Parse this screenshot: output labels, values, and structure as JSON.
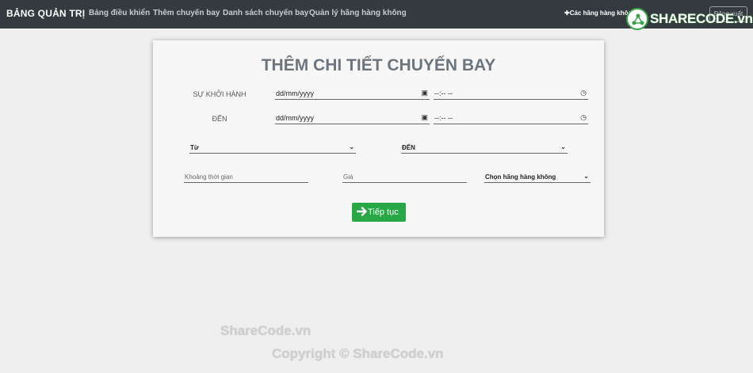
{
  "navbar": {
    "brand": "BẢNG QUẢN TRỊ",
    "links": [
      "Bảng điều khiển",
      "Thêm chuyến bay",
      "Danh sách chuyến bay",
      "Quản lý hãng hàng không"
    ],
    "right_link": "Các hãng hàng không",
    "logout_label": "Đăng xuất"
  },
  "logo": {
    "text": "SHARECODE.vn"
  },
  "form": {
    "title": "THÊM CHI TIẾT CHUYẾN BAY",
    "departure_label": "SỰ KHỞI HÀNH",
    "arrival_label": "ĐẾN",
    "date_placeholder": "dd/mm/yyyy",
    "time_placeholder": "--:-- --",
    "from_label": "Từ",
    "to_label": "ĐẾN",
    "duration_placeholder": "Khoảng thời gian",
    "price_placeholder": "Giá",
    "airline_label": "Chọn hãng hàng không",
    "submit_label": "Tiếp tục"
  },
  "watermark": {
    "main": "ShareCode.vn",
    "copyright": "Copyright © ShareCode.vn"
  }
}
